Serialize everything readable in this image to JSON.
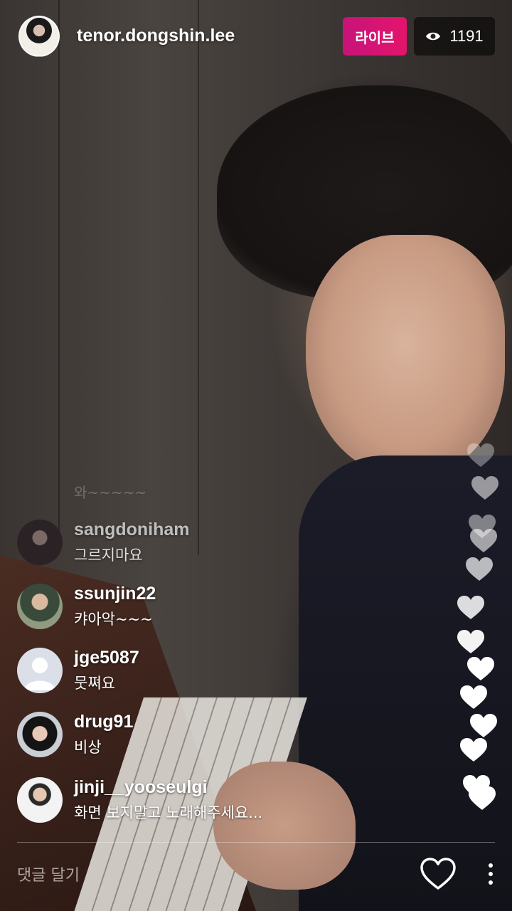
{
  "header": {
    "username": "tenor.dongshin.lee",
    "live_label": "라이브",
    "viewer_count": "1191",
    "viewer_icon": "eye-icon"
  },
  "faded_comment": "와~~~~~",
  "comments": [
    {
      "username": "sangdoniham",
      "text": "그르지마요",
      "avatar": "avatar-dark-portrait"
    },
    {
      "username": "ssunjin22",
      "text": "캬아악~~~",
      "avatar": "avatar-photo"
    },
    {
      "username": "jge5087",
      "text": "뭇쪄요",
      "avatar": "default-avatar-icon"
    },
    {
      "username": "drug91",
      "text": "비상",
      "avatar": "avatar-photo"
    },
    {
      "username": "jinji__yooseulgi",
      "text": "화면 보지말고 노래해주세요...",
      "avatar": "avatar-photo"
    }
  ],
  "footer": {
    "comment_placeholder": "댓글 달기",
    "like_icon": "heart-outline-icon",
    "more_icon": "more-vertical-icon"
  },
  "colors": {
    "live_badge": "#e4146b",
    "heart": "#ffffff"
  }
}
